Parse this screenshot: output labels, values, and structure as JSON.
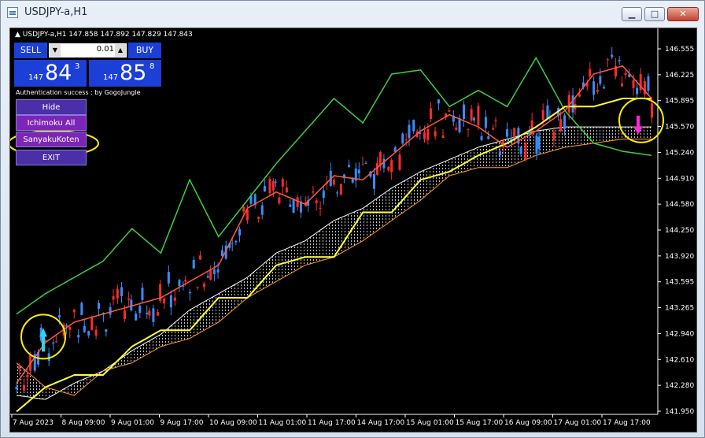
{
  "window": {
    "title": "USDJPY-a,H1",
    "buttons": [
      "minimize",
      "maximize",
      "close"
    ]
  },
  "chart_header": {
    "symbol_line": "▲ USDJPY-a,H1  147.858 147.892 147.829 147.843"
  },
  "trade_panel": {
    "sell_label": "SELL",
    "buy_label": "BUY",
    "lot_value": "0.01",
    "sell_price": {
      "prefix": "147",
      "big": "84",
      "sup": "3"
    },
    "buy_price": {
      "prefix": "147",
      "big": "85",
      "sup": "8"
    },
    "auth_text": "Authentication success : by GogoJungle"
  },
  "indicator_menu": {
    "items": [
      {
        "label": "Hide"
      },
      {
        "label": "Ichimoku All"
      },
      {
        "label": "SanyakuKoten"
      },
      {
        "label": "EXIT"
      }
    ]
  },
  "price_axis": {
    "labels": [
      "146.555",
      "146.225",
      "145.895",
      "145.570",
      "145.240",
      "144.910",
      "144.580",
      "144.250",
      "143.920",
      "143.595",
      "143.265",
      "142.940",
      "142.610",
      "142.280",
      "141.950"
    ]
  },
  "date_axis": {
    "labels": [
      "7 Aug 2023",
      "8 Aug 09:00",
      "9 Aug 01:00",
      "9 Aug 17:00",
      "10 Aug 09:00",
      "11 Aug 01:00",
      "11 Aug 17:00",
      "14 Aug 17:00",
      "15 Aug 01:00",
      "15 Aug 17:00",
      "16 Aug 09:00",
      "17 Aug 01:00",
      "17 Aug 17:00"
    ]
  },
  "chart_data": {
    "type": "line",
    "symbol": "USDJPY-a",
    "timeframe": "H1",
    "ylim": [
      141.95,
      146.6
    ],
    "colors": {
      "background": "#000000",
      "bull_candle": "#3a8cff",
      "bear_candle": "#ff2a2a",
      "tenkan": "#ff5a3c",
      "kijun": "#ffff3c",
      "chikou": "#3cd23c",
      "cloud_top": "#ffffff",
      "cloud_bottom": "#ff9b28",
      "buy_arrow": "#28d4f0",
      "sell_arrow": "#ff2ad8",
      "highlight_circle": "#ffee00"
    },
    "series": [
      {
        "name": "Kijun",
        "values": [
          142.1,
          142.4,
          142.55,
          142.55,
          142.9,
          143.1,
          143.1,
          143.5,
          143.5,
          143.9,
          144.0,
          144.0,
          144.55,
          144.55,
          144.95,
          145.05,
          145.25,
          145.4,
          145.6,
          145.85,
          145.85,
          145.95,
          145.95
        ]
      },
      {
        "name": "Tenkan",
        "values": [
          142.45,
          142.95,
          143.2,
          143.3,
          143.4,
          143.5,
          143.7,
          143.9,
          144.6,
          144.8,
          144.65,
          145.0,
          144.95,
          145.25,
          145.55,
          145.75,
          145.6,
          145.35,
          145.55,
          145.8,
          146.25,
          146.35,
          145.95
        ]
      },
      {
        "name": "Chikou",
        "values": [
          143.3,
          143.55,
          143.75,
          143.95,
          144.35,
          144.05,
          144.95,
          144.25,
          144.7,
          145.15,
          145.55,
          145.95,
          145.65,
          146.25,
          146.3,
          145.85,
          146.05,
          145.85,
          146.45,
          145.8,
          145.4,
          145.3,
          145.25
        ]
      },
      {
        "name": "Span A",
        "values": [
          142.3,
          142.25,
          142.45,
          142.6,
          142.85,
          143.05,
          143.35,
          143.55,
          143.75,
          144.05,
          144.2,
          144.45,
          144.6,
          144.85,
          145.05,
          145.2,
          145.35,
          145.45,
          145.55,
          145.6,
          145.6,
          145.6,
          145.6
        ]
      },
      {
        "name": "Span B",
        "values": [
          142.7,
          142.4,
          142.3,
          142.6,
          142.7,
          142.9,
          143.0,
          143.2,
          143.5,
          143.7,
          143.9,
          144.0,
          144.2,
          144.45,
          144.7,
          145.0,
          145.1,
          145.1,
          145.25,
          145.35,
          145.4,
          145.45,
          145.45
        ]
      }
    ],
    "signals": [
      {
        "type": "buy",
        "time": "7 Aug 2023",
        "price": 143.05
      },
      {
        "type": "sell",
        "time": "17 Aug 17:00",
        "price": 145.7
      }
    ]
  }
}
